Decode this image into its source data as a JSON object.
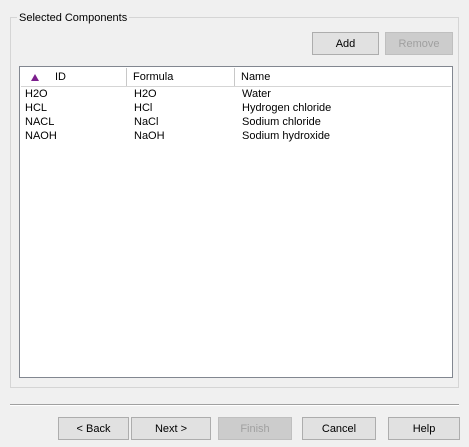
{
  "group": {
    "title": "Selected Components"
  },
  "toolbar": {
    "add_label": "Add",
    "remove_label": "Remove"
  },
  "table": {
    "sort_icon": "sort-ascending-icon",
    "columns": [
      "ID",
      "Formula",
      "Name"
    ],
    "rows": [
      {
        "id": "H2O",
        "formula": "H2O",
        "name": "Water"
      },
      {
        "id": "HCL",
        "formula": "HCl",
        "name": "Hydrogen chloride"
      },
      {
        "id": "NACL",
        "formula": "NaCl",
        "name": "Sodium chloride"
      },
      {
        "id": "NAOH",
        "formula": "NaOH",
        "name": "Sodium hydroxide"
      }
    ]
  },
  "wizard": {
    "back_label": "< Back",
    "next_label": "Next >",
    "finish_label": "Finish",
    "cancel_label": "Cancel",
    "help_label": "Help"
  },
  "colors": {
    "sort_icon": "#7b1e8c",
    "disabled_text": "#a0a0a0"
  }
}
